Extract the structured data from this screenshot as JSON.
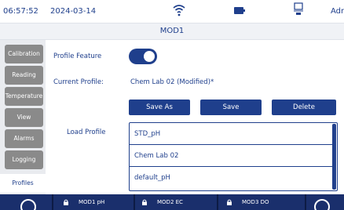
{
  "status": {
    "time": "06:57:52",
    "date": "2024-03-14",
    "user": "Adm"
  },
  "header": {
    "title": "MOD1"
  },
  "nav": {
    "items": [
      {
        "label": "Calibration"
      },
      {
        "label": "Reading"
      },
      {
        "label": "Temperature"
      },
      {
        "label": "View"
      },
      {
        "label": "Alarms"
      },
      {
        "label": "Logging"
      },
      {
        "label": "Profiles",
        "active": true
      }
    ]
  },
  "profile": {
    "feature_label": "Profile Feature",
    "feature_on": true,
    "current_label": "Current Profile:",
    "current_value": "Chem Lab 02 (Modified)*",
    "save_as": "Save As",
    "save": "Save",
    "delete": "Delete",
    "load_label": "Load Profile",
    "list": [
      "STD_pH",
      "Chem Lab 02",
      "default_pH"
    ]
  },
  "bottom": {
    "tabs": [
      {
        "label": "MOD1 pH"
      },
      {
        "label": "MOD2 EC"
      },
      {
        "label": "MOD3 DO"
      }
    ]
  },
  "colors": {
    "accent": "#1f3f8c",
    "nav_button": "#8a8a8a",
    "bottom_bar": "#1a2f6c"
  }
}
